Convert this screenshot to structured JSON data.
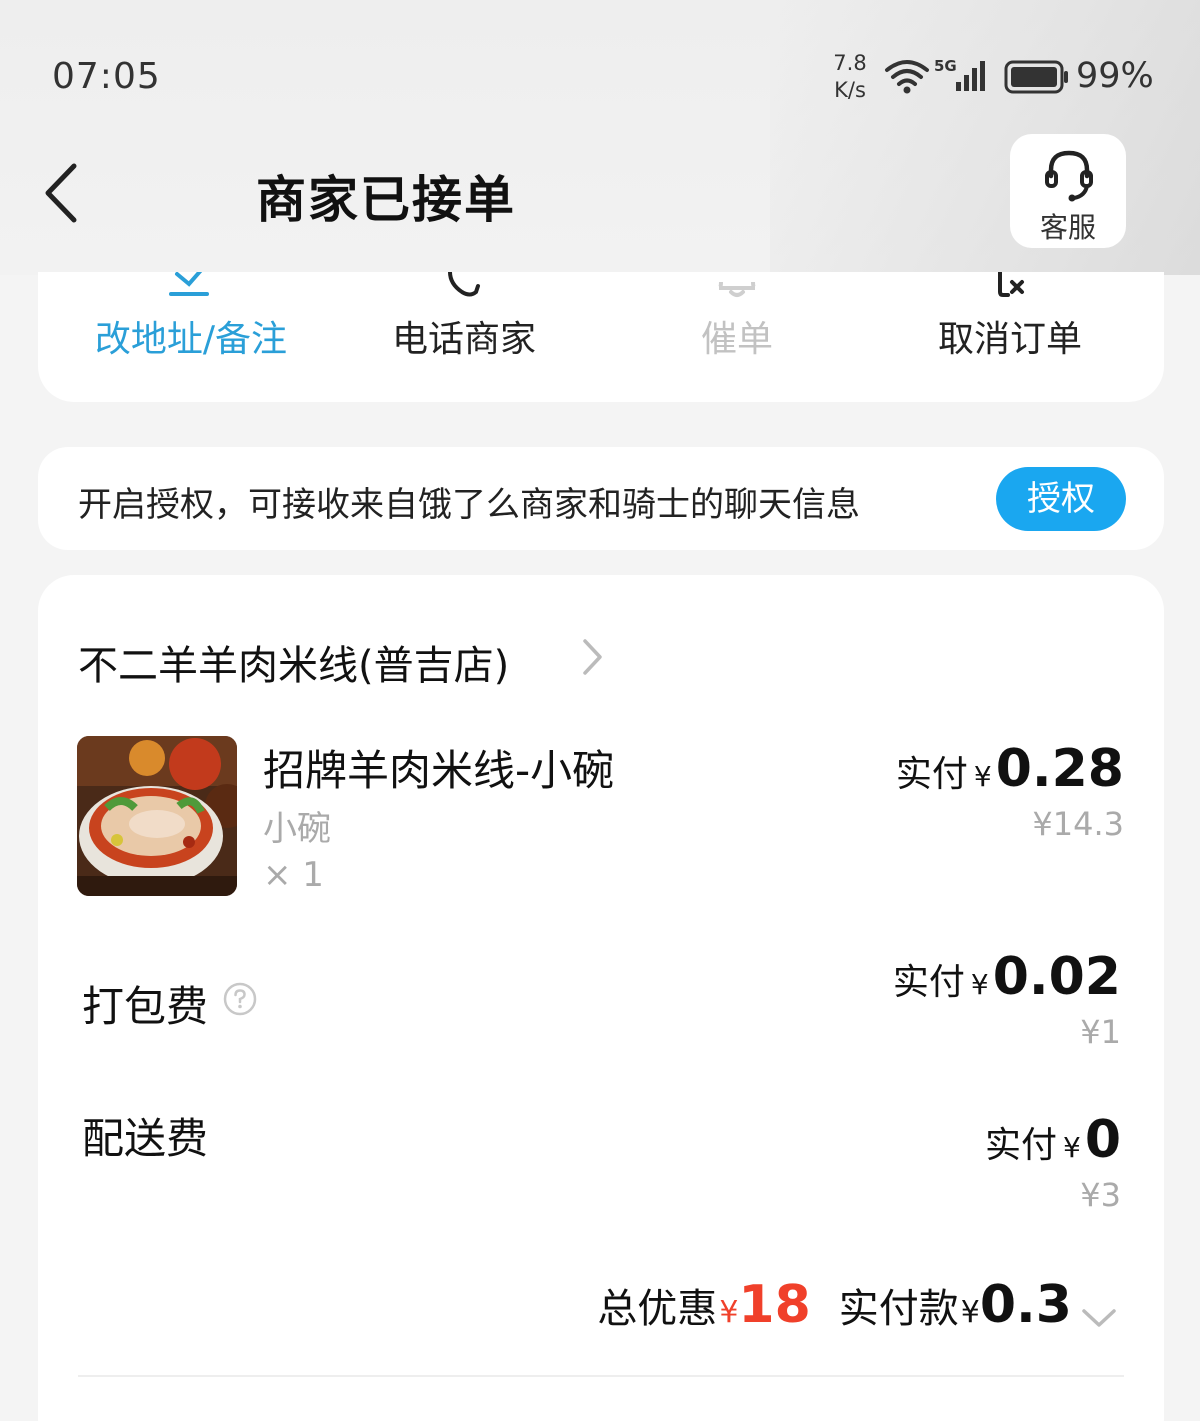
{
  "status_bar": {
    "time": "07:05",
    "net_speed_value": "7.8",
    "net_speed_unit": "K/s",
    "network_type": "5G",
    "battery_percent": "99%"
  },
  "header": {
    "title": "商家已接单",
    "service_label": "客服"
  },
  "actions": [
    {
      "label": "改地址/备注",
      "icon": "edit-icon",
      "color": "#2a9fd8"
    },
    {
      "label": "电话商家",
      "icon": "phone-icon"
    },
    {
      "label": "催单",
      "icon": "bell-icon",
      "disabled": true
    },
    {
      "label": "取消订单",
      "icon": "cancel-icon"
    }
  ],
  "auth_banner": {
    "text": "开启授权，可接收来自饿了么商家和骑士的聊天信息",
    "button_label": "授权",
    "button_color": "#1aa7f0"
  },
  "order": {
    "shop_name": "不二羊羊肉米线(普吉店)",
    "item": {
      "name": "招牌羊肉米线-小碗",
      "spec": "小碗",
      "quantity": "× 1",
      "pay_label": "实付",
      "currency": "¥",
      "pay_amount": "0.28",
      "original_price": "¥14.3"
    },
    "packing_fee": {
      "label": "打包费",
      "pay_label": "实付",
      "currency": "¥",
      "pay_amount": "0.02",
      "original_price": "¥1"
    },
    "delivery_fee": {
      "label": "配送费",
      "pay_label": "实付",
      "currency": "¥",
      "pay_amount": "0",
      "original_price": "¥3"
    },
    "summary": {
      "discount_label": "总优惠",
      "currency": "¥",
      "discount_amount": "18",
      "paid_label": "实付款",
      "paid_amount": "0.3"
    },
    "accent_red": "#f0402a"
  }
}
